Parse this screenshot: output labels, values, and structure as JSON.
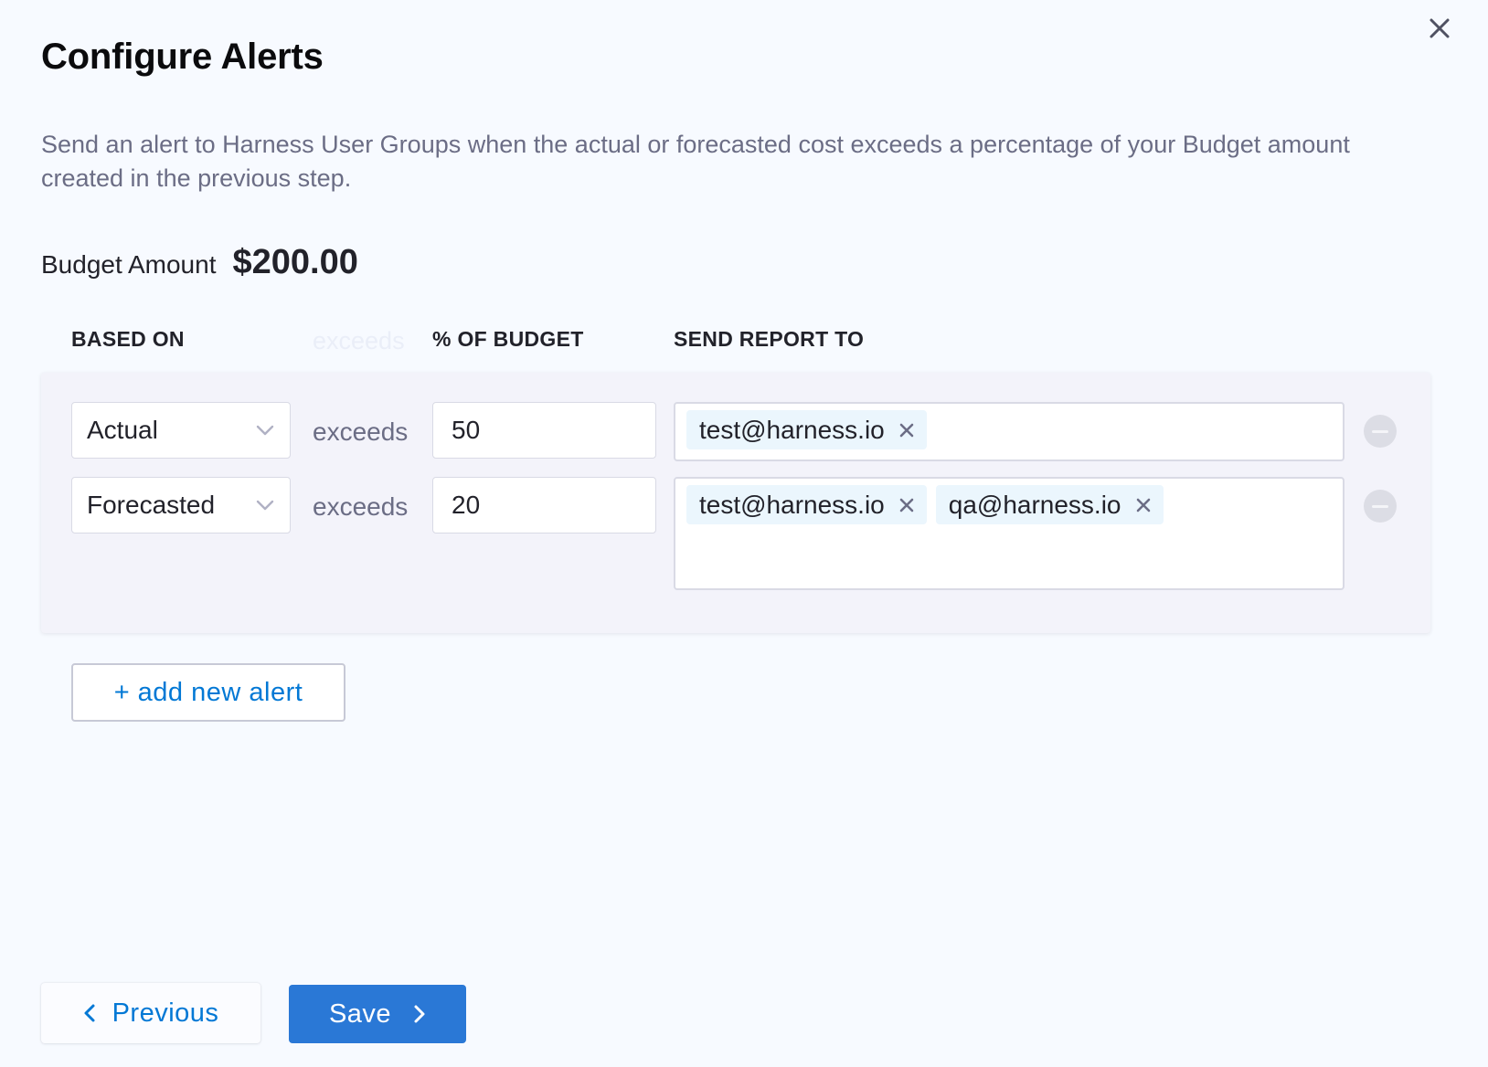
{
  "dialog": {
    "title": "Configure Alerts",
    "description": "Send an alert to Harness User Groups when the actual or forecasted cost exceeds a percentage of your Budget amount created in the previous step.",
    "close_icon": "close-icon"
  },
  "budget": {
    "label": "Budget Amount",
    "value": "$200.00"
  },
  "table": {
    "headers": {
      "based_on": "BASED ON",
      "ghost": "exceeds",
      "percent": "% OF BUDGET",
      "send_to": "SEND REPORT TO"
    },
    "rows": [
      {
        "based_on": "Actual",
        "exceeds": "exceeds",
        "percent": "50",
        "recipients": [
          "test@harness.io"
        ]
      },
      {
        "based_on": "Forecasted",
        "exceeds": "exceeds",
        "percent": "20",
        "recipients": [
          "test@harness.io",
          "qa@harness.io"
        ]
      }
    ]
  },
  "actions": {
    "add_alert": "+ add new alert",
    "previous": "Previous",
    "save": "Save"
  },
  "colors": {
    "background": "#f7faff",
    "primary": "#2a78d6",
    "link": "#0278d5",
    "tag_bg": "#ebf6fd",
    "card_bg": "#f3f3fa"
  }
}
